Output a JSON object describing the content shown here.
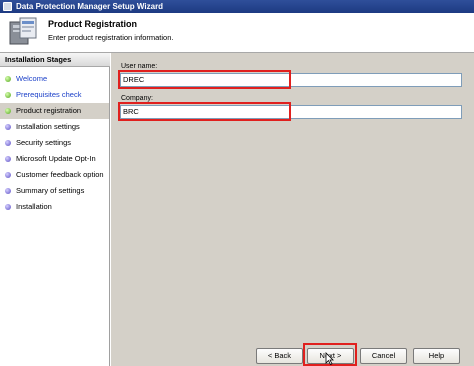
{
  "window": {
    "title": "Data Protection Manager Setup Wizard"
  },
  "header": {
    "title": "Product Registration",
    "subtitle": "Enter product registration information."
  },
  "sidebar": {
    "heading": "Installation Stages",
    "stages": [
      {
        "label": "Welcome",
        "state": "done",
        "bullet": "green"
      },
      {
        "label": "Prerequisites check",
        "state": "done",
        "bullet": "green"
      },
      {
        "label": "Product registration",
        "state": "current",
        "bullet": "green"
      },
      {
        "label": "Installation settings",
        "state": "pending",
        "bullet": "purple"
      },
      {
        "label": "Security settings",
        "state": "pending",
        "bullet": "purple"
      },
      {
        "label": "Microsoft Update Opt-In",
        "state": "pending",
        "bullet": "purple"
      },
      {
        "label": "Customer feedback option",
        "state": "pending",
        "bullet": "purple"
      },
      {
        "label": "Summary of settings",
        "state": "pending",
        "bullet": "purple"
      },
      {
        "label": "Installation",
        "state": "pending",
        "bullet": "purple"
      }
    ]
  },
  "form": {
    "user_name_label": "User name:",
    "user_name_value": "DREC",
    "company_label": "Company:",
    "company_value": "BRC"
  },
  "buttons": {
    "back": "< Back",
    "next": "Next >",
    "cancel": "Cancel",
    "help": "Help"
  },
  "colors": {
    "highlight": "#e0201e",
    "link": "#1a3fc8",
    "titlebar": "#1d3a82"
  }
}
